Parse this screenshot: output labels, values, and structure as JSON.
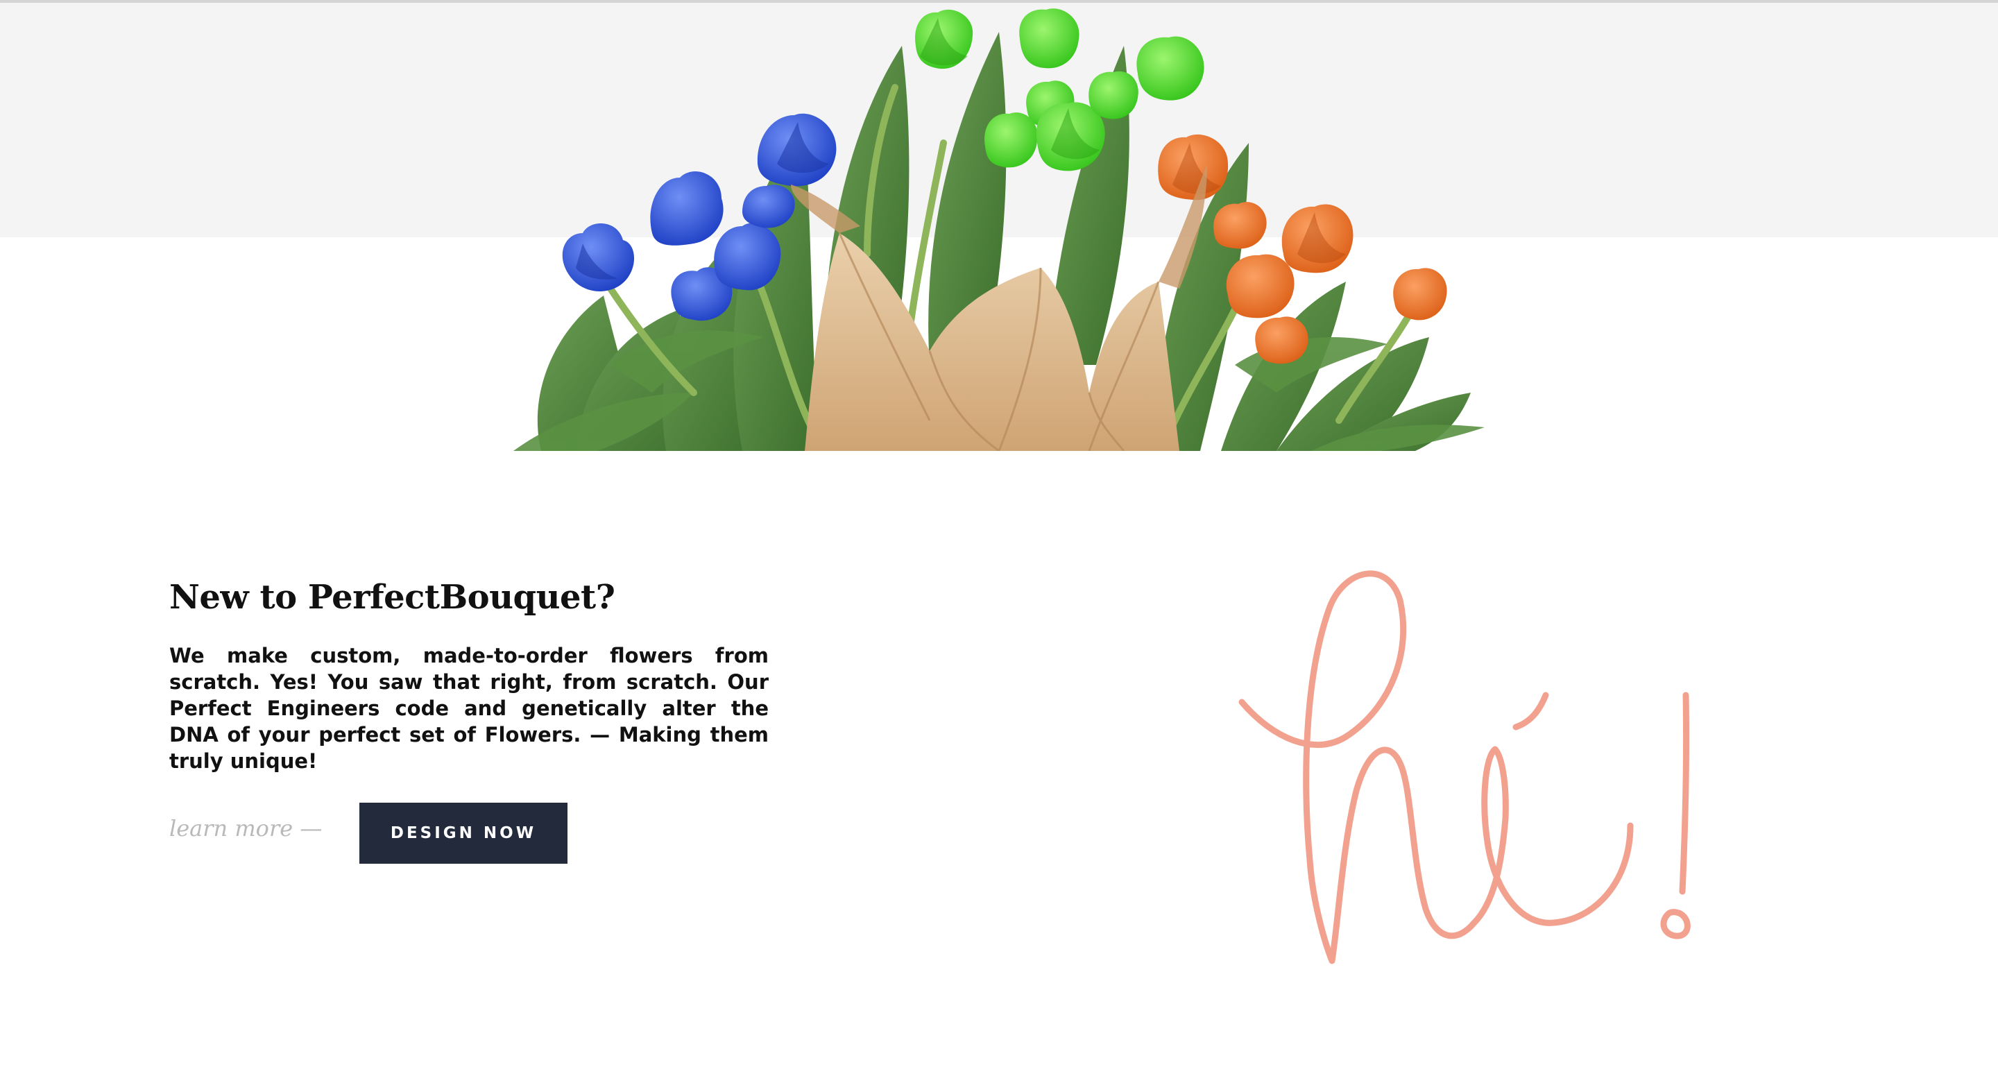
{
  "hero": {
    "image": "tulip-bouquet",
    "colors": {
      "band": "#f4f4f4",
      "tulip_blue": "#2e57e0",
      "tulip_green": "#4fe32a",
      "tulip_orange": "#f0762a",
      "leaf": "#4f8a3a",
      "paper": "#dcb68a"
    }
  },
  "intro": {
    "heading": "New to PerfectBouquet?",
    "body": "We make custom, made-to-order flowers from scratch. Yes! You saw that right, from scratch. Our Perfect Engineers code and genetically alter the DNA of your perfect set of Flowers. — Making them truly unique!"
  },
  "actions": {
    "learn_more": "learn more —",
    "design_now": "DESIGN NOW",
    "button_color": "#222a3c"
  },
  "greeting": {
    "image": "handwritten-hi",
    "color": "#f3a18f"
  }
}
